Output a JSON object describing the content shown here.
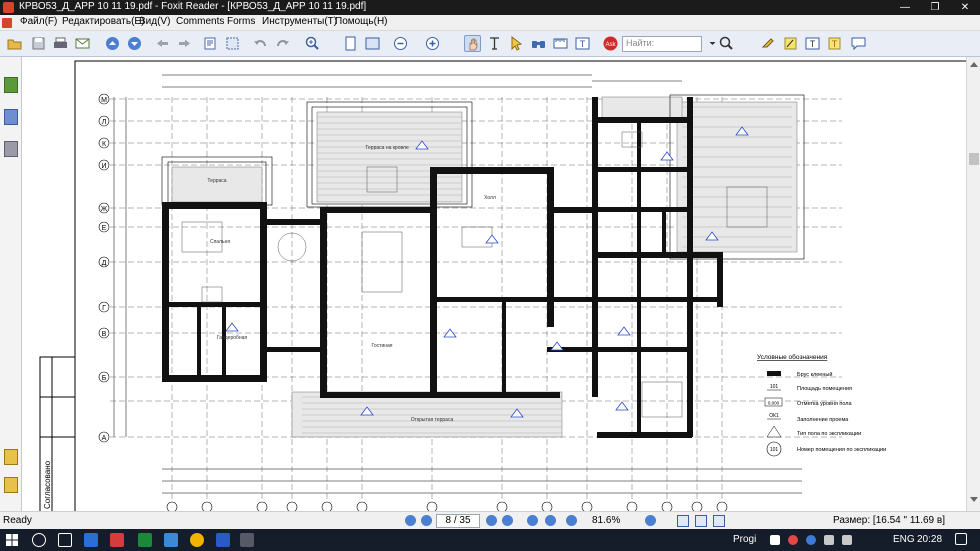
{
  "window": {
    "title": "КРВО53_Д_АРР 10 11 19.pdf - Foxit Reader - [КРВО53_Д_АРР 10 11 19.pdf]",
    "minimize": "—",
    "restore": "❐",
    "close": "✕"
  },
  "menu": {
    "file": "Файл(F)",
    "edit": "Редактировать(E)",
    "view": "Вид(V)",
    "comments": "Comments",
    "forms": "Forms",
    "tools": "Инструменты(T)",
    "help": "Помощь(H)"
  },
  "toolbar": {
    "search_placeholder": "Найти:"
  },
  "drawing": {
    "legend_title": "Условные обозначения",
    "legend": [
      "Брус клееный",
      "Площадь помещения",
      "Отметка уровня пола",
      "Заполнение проема",
      "Тип пола по экспликации",
      "Номер помещения по экспликации"
    ],
    "legend_symbols": [
      "101",
      "0,000",
      "ОК1",
      "101"
    ],
    "stamp_text": "Согласовано",
    "rows": [
      "М",
      "Л",
      "К",
      "И",
      "Ж",
      "Е",
      "Д",
      "Г",
      "В",
      "Б",
      "А"
    ],
    "room_terrace_top": "Терраса на кровле",
    "room_hall": "Холл",
    "room_living": "Гостиная",
    "room_bedroom": "Спальня",
    "room_wardrobe": "Гардеробная",
    "room_terrace": "Терраса",
    "room_open_terrace": "Открытая терраса"
  },
  "status": {
    "ready": "Ready",
    "page": "8 / 35",
    "zoom": "81.6%",
    "size": "Размер: [16.54 \" 11.69 в]"
  },
  "taskbar": {
    "progi": "Progi",
    "lang": "ENG",
    "time": "20:28"
  }
}
